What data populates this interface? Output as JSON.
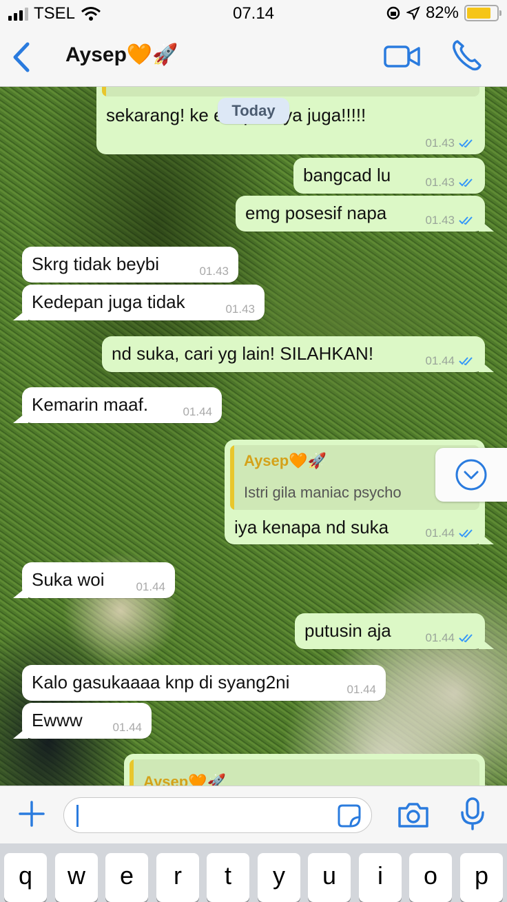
{
  "status_bar": {
    "carrier": "TSEL",
    "time": "07.14",
    "battery": "82%",
    "battery_level": 0.82
  },
  "header": {
    "contact_name": "Aysep🧡🚀",
    "back_icon": "chevron-left-icon",
    "video_icon": "video-camera-icon",
    "call_icon": "phone-icon"
  },
  "chat": {
    "date_badge": "Today",
    "messages": [
      {
        "direction": "out",
        "text": "sekarang! ke  edepannya juga!!!!!",
        "time": "01.43",
        "read": true
      },
      {
        "direction": "out",
        "text": "bangcad lu",
        "time": "01.43",
        "read": true
      },
      {
        "direction": "out",
        "text": "emg posesif napa",
        "time": "01.43",
        "read": true
      },
      {
        "direction": "in",
        "text": "Skrg tidak beybi",
        "time": "01.43"
      },
      {
        "direction": "in",
        "text": "Kedepan juga tidak",
        "time": "01.43"
      },
      {
        "direction": "out",
        "text": "nd suka, cari yg lain! SILAHKAN!",
        "time": "01.44",
        "read": true
      },
      {
        "direction": "in",
        "text": "Kemarin maaf.",
        "time": "01.44"
      },
      {
        "direction": "out",
        "quote_name": "Aysep🧡🚀",
        "quote_text": "Istri gila maniac psycho",
        "text": "iya kenapa nd suka",
        "time": "01.44",
        "read": true
      },
      {
        "direction": "in",
        "text": "Suka woi",
        "time": "01.44"
      },
      {
        "direction": "out",
        "text": "putusin aja",
        "time": "01.44",
        "read": true
      },
      {
        "direction": "in",
        "text": "Kalo gasukaaaa knp di syang2ni",
        "time": "01.44"
      },
      {
        "direction": "in",
        "text": "Ewww",
        "time": "01.44"
      },
      {
        "direction": "out",
        "quote_name": "Aysep🧡🚀"
      }
    ]
  },
  "input_bar": {
    "placeholder": "",
    "icons": [
      "plus-icon",
      "sticker-icon",
      "camera-icon",
      "microphone-icon"
    ]
  },
  "keyboard": {
    "row1": [
      "q",
      "w",
      "e",
      "r",
      "t",
      "y",
      "u",
      "i",
      "o",
      "p"
    ]
  },
  "colors": {
    "accent": "#2a7bde",
    "outgoing_bubble": "#dcf8c6",
    "incoming_bubble": "#ffffff",
    "quote_name": "#d4a21a",
    "read_tick": "#3497f9"
  }
}
